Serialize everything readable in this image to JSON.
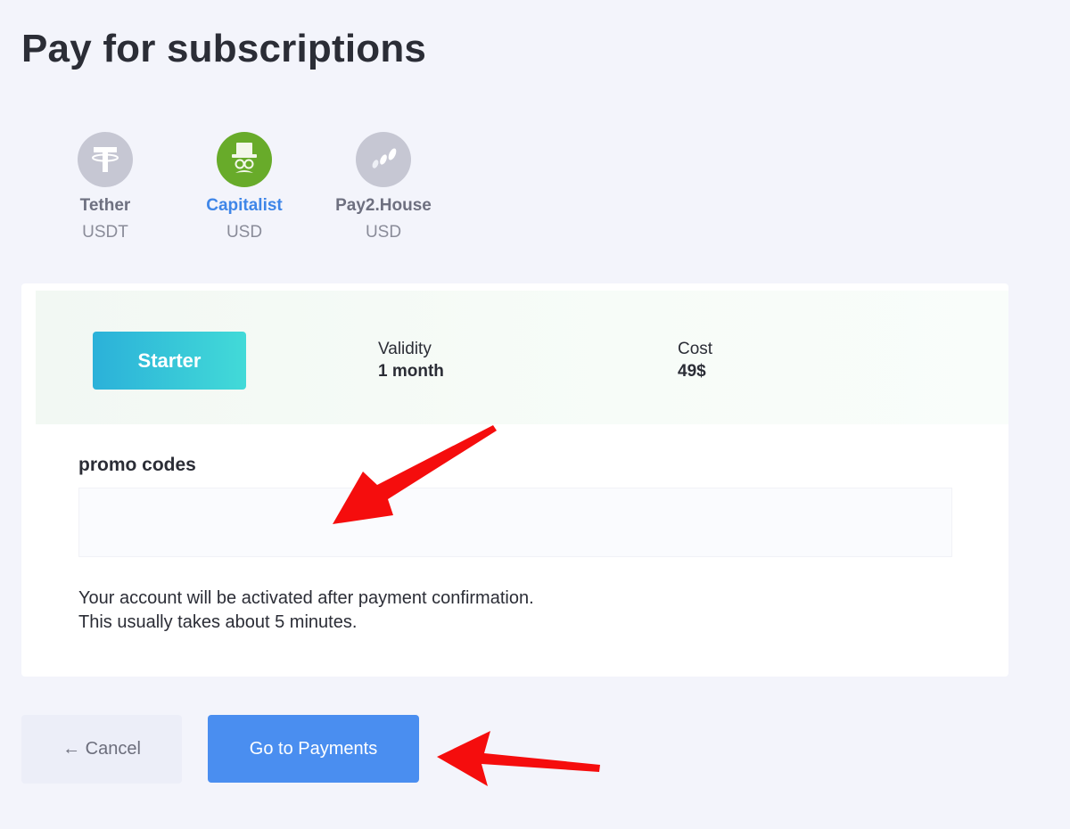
{
  "page": {
    "title": "Pay for subscriptions"
  },
  "payment_methods": [
    {
      "name": "Tether",
      "currency": "USDT",
      "icon": "tether-icon",
      "selected": false
    },
    {
      "name": "Capitalist",
      "currency": "USD",
      "icon": "capitalist-icon",
      "selected": true
    },
    {
      "name": "Pay2.House",
      "currency": "USD",
      "icon": "pay2house-icon",
      "selected": false
    }
  ],
  "plan": {
    "name": "Starter",
    "validity_label": "Validity",
    "validity_value": "1 month",
    "cost_label": "Cost",
    "cost_value": "49$"
  },
  "promo": {
    "label": "promo codes",
    "value": "",
    "placeholder": ""
  },
  "note": {
    "line1": "Your account will be activated after payment confirmation.",
    "line2": "This usually takes about 5 minutes."
  },
  "actions": {
    "cancel_label": "← Cancel",
    "pay_label": "Go to Payments"
  },
  "colors": {
    "accent": "#4a8ef0",
    "selected_method": "#68ab2a",
    "plan_badge_gradient": [
      "#2bb1d9",
      "#42dad8"
    ],
    "annotation_arrow": "#f50d0d"
  }
}
